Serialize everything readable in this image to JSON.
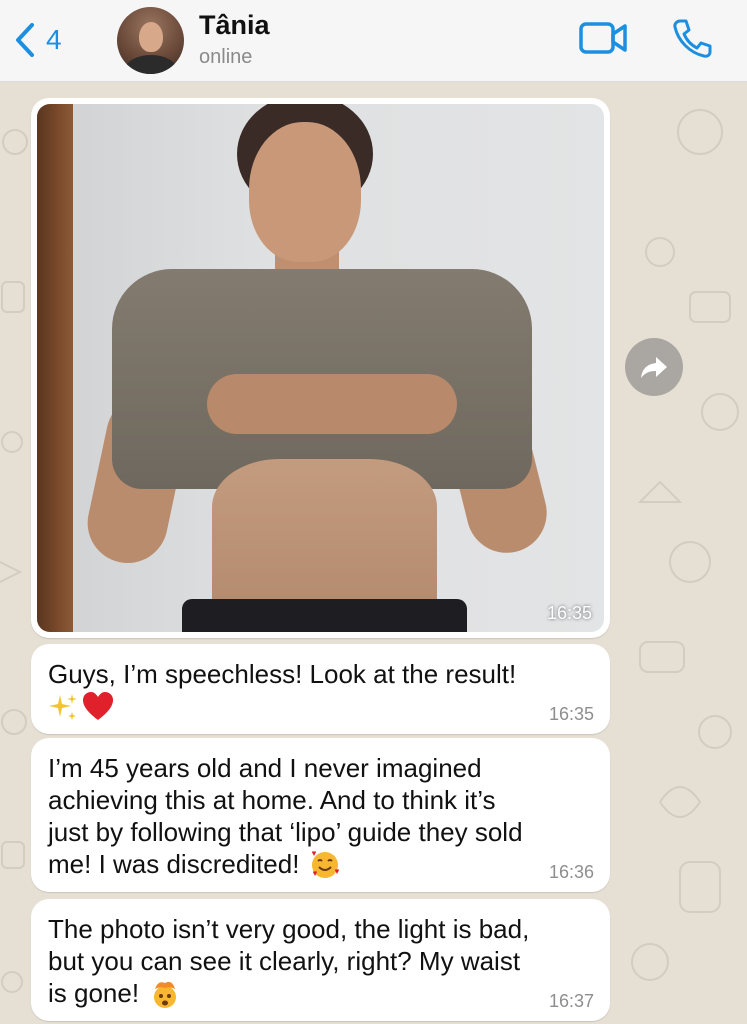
{
  "header": {
    "back_count": "4",
    "contact_name": "Tânia",
    "contact_status": "online"
  },
  "image_message": {
    "time": "16:35",
    "alt": "Photo of a woman lifting her shirt to show her abdomen"
  },
  "messages": [
    {
      "text": "Guys, I’m speechless! Look at the result!",
      "emoji": [
        "sparkles",
        "red-heart"
      ],
      "time": "16:35"
    },
    {
      "text": "I’m 45 years old and I never imagined\nachieving this at home. And to think it’s\njust by following that ‘lipo’ guide they sold\nme! I was discredited!",
      "emoji": [
        "smiling-face-with-hearts"
      ],
      "time": "16:36"
    },
    {
      "text": "The photo isn’t very good, the light is bad,\nbut you can see it clearly, right? My waist\nis gone!",
      "emoji": [
        "exploding-head"
      ],
      "time": "16:37"
    }
  ],
  "colors": {
    "accent": "#1d8fe0",
    "chat_background": "#e6dfd4",
    "bubble": "#ffffff"
  }
}
